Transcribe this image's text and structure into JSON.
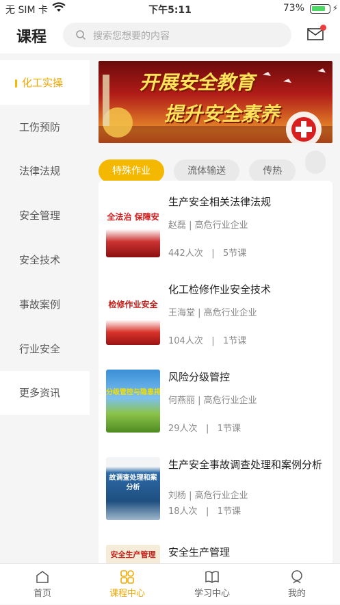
{
  "status": {
    "carrier": "无 SIM 卡",
    "time": "下午5:11",
    "battery": "73%"
  },
  "header": {
    "title": "课程",
    "search_placeholder": "搜索您想要的内容"
  },
  "sidebar": {
    "items": [
      {
        "label": "化工实操"
      },
      {
        "label": "工伤预防"
      },
      {
        "label": "法律法规"
      },
      {
        "label": "安全管理"
      },
      {
        "label": "安全技术"
      },
      {
        "label": "事故案例"
      },
      {
        "label": "行业安全"
      },
      {
        "label": "更多资讯"
      }
    ]
  },
  "banner": {
    "line1": "开展安全教育",
    "line2": "提升安全素养"
  },
  "chips": [
    {
      "label": "特殊作业"
    },
    {
      "label": "流体输送"
    },
    {
      "label": "传热"
    }
  ],
  "courses": [
    {
      "title": "生产安全相关法律法规",
      "teacher": "赵磊 | 高危行业企业",
      "views": "442人次",
      "sep": "|",
      "lessons": "5节课",
      "thumb_text": "全法治 保障安"
    },
    {
      "title": "化工检修作业安全技术",
      "teacher": "王海堂 | 高危行业企业",
      "views": "104人次",
      "sep": "|",
      "lessons": "1节课",
      "thumb_text": "检修作业安全"
    },
    {
      "title": "风险分级管控",
      "teacher": "何燕丽 | 高危行业企业",
      "views": "29人次",
      "sep": "|",
      "lessons": "1节课",
      "thumb_text": "分级管控与隐患排查"
    },
    {
      "title": "生产安全事故调查处理和案例分析",
      "teacher": "刘杨 | 高危行业企业",
      "views": "18人次",
      "sep": "|",
      "lessons": "1节课",
      "thumb_text": "故调查处理和案分析"
    },
    {
      "title": "安全生产管理",
      "thumb_text": "安全生产管理"
    }
  ],
  "tabs": [
    {
      "label": "首页"
    },
    {
      "label": "课程中心"
    },
    {
      "label": "学习中心"
    },
    {
      "label": "我的"
    }
  ],
  "colors": {
    "accent": "#f5b800",
    "accent_text": "#f0a800",
    "badge": "#ee3b3b"
  }
}
